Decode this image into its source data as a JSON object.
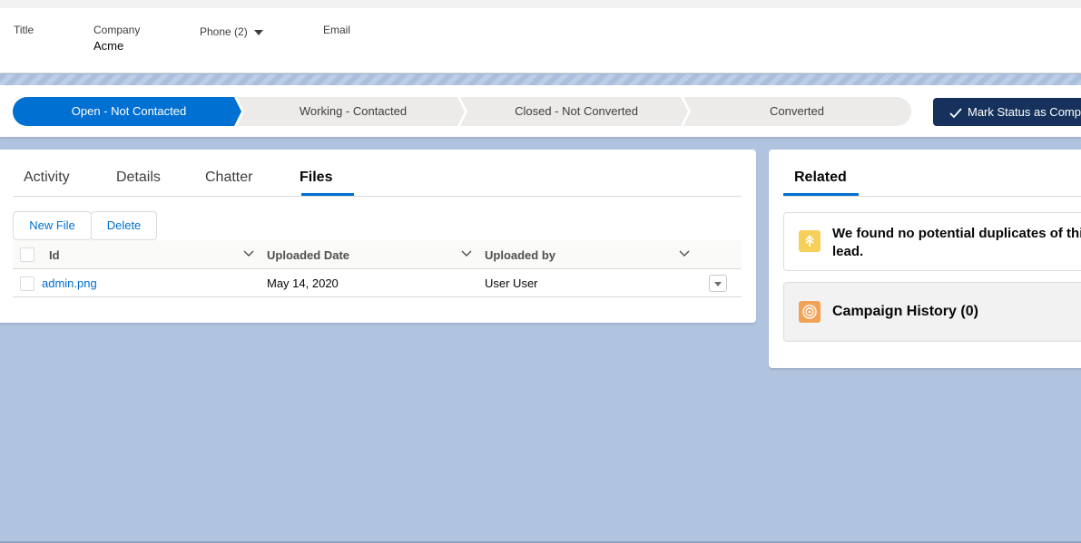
{
  "highlights": {
    "fields": [
      {
        "label": "Title",
        "value": ""
      },
      {
        "label": "Company",
        "value": "Acme"
      },
      {
        "label": "Phone (2)",
        "value": ""
      },
      {
        "label": "Email",
        "value": ""
      }
    ]
  },
  "path": {
    "stages": [
      {
        "label": "Open - Not Contacted",
        "active": true
      },
      {
        "label": "Working - Contacted",
        "active": false
      },
      {
        "label": "Closed - Not Converted",
        "active": false
      },
      {
        "label": "Converted",
        "active": false
      }
    ],
    "mark_button": "Mark Status as Comp",
    "colors": {
      "active": "#0070d2",
      "inactive": "#ecebea",
      "button": "#16325c"
    }
  },
  "tabs": [
    "Activity",
    "Details",
    "Chatter",
    "Files"
  ],
  "active_tab": "Files",
  "files": {
    "buttons": {
      "new_file": "New File",
      "delete": "Delete"
    },
    "columns": [
      "Id",
      "Uploaded Date",
      "Uploaded by"
    ],
    "rows": [
      {
        "id": "admin.png",
        "uploaded_date": "May 14, 2020",
        "uploaded_by": "User User"
      }
    ]
  },
  "related": {
    "tab": "Related",
    "duplicates_text": "We found no potential duplicates of this lead.",
    "campaign_history": "Campaign History (0)",
    "icons": {
      "duplicates": "duplicate-icon",
      "campaign": "campaign-target-icon"
    }
  }
}
